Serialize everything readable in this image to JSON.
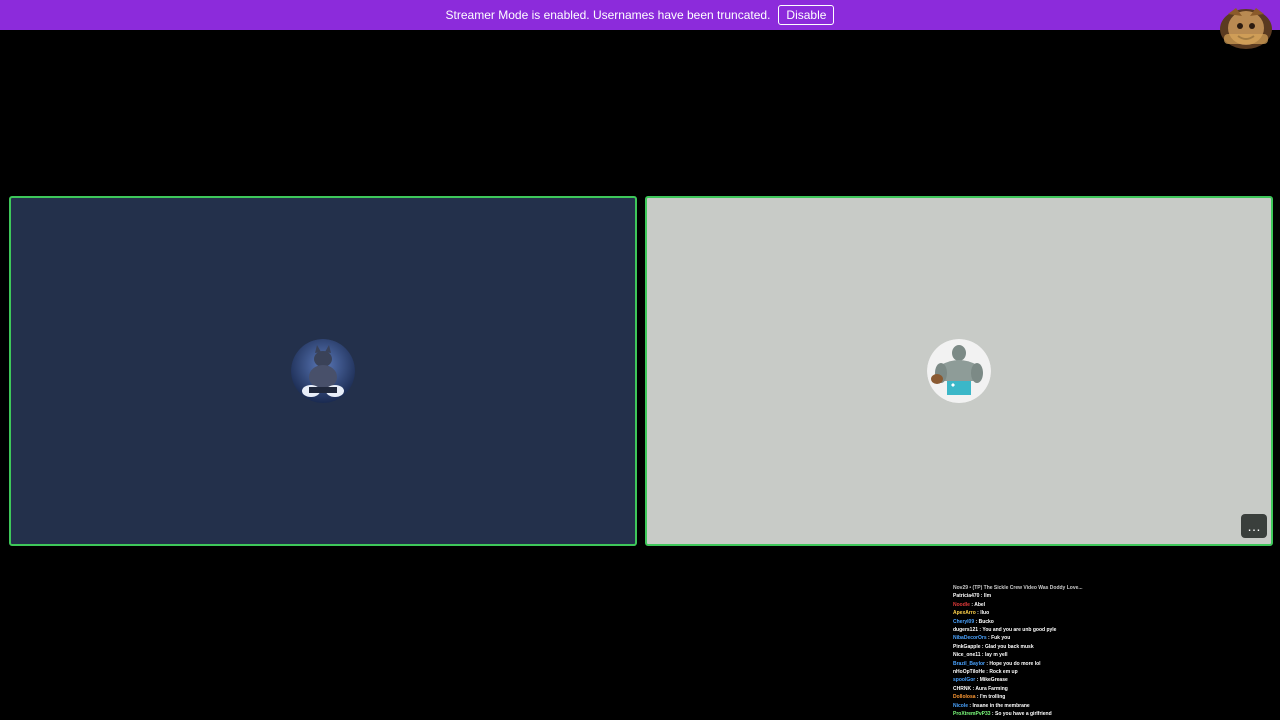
{
  "banner": {
    "text": "Streamer Mode is enabled. Usernames have been truncated.",
    "button_label": "Disable"
  },
  "tiles": [
    {
      "name": "tile-left",
      "avatar_icon": "cat-avatar-icon",
      "background": "#23304b"
    },
    {
      "name": "tile-right",
      "avatar_icon": "hulk-avatar-icon",
      "background": "#c8cbc7",
      "more_icon": "more-options-icon",
      "more_label": "…"
    }
  ],
  "colors": {
    "banner": "#8c2bdb",
    "speaking_border": "#3ec75a",
    "background": "#000000"
  },
  "chat": {
    "partial_top": "Nov29 • (TP) The Sickle Crew Video Was Doddy Love...",
    "messages": [
      {
        "user": "Patricia470",
        "sep": " : ",
        "text": "llm",
        "color": "#ffffff"
      },
      {
        "user": "Noodle",
        "sep": " : ",
        "text": "Abel",
        "color": "#e23a3a"
      },
      {
        "user": "ApexArro",
        "sep": " : ",
        "text": "lluo",
        "color": "#ffd24a"
      },
      {
        "user": "Cheryl09",
        "sep": " : ",
        "text": "Bucko",
        "color": "#4aa3ff"
      },
      {
        "user": "dugers121",
        "sep": " : ",
        "text": "You and you are unb good pyle",
        "color": "#ffffff"
      },
      {
        "user": "NibaDecorOrs",
        "sep": " : ",
        "text": "Fuk you",
        "color": "#4aa3ff"
      },
      {
        "user": "PinkGapple",
        "sep": " : ",
        "text": "Glad you back musk",
        "color": "#ffffff"
      },
      {
        "user": "Nice_one11",
        "sep": " : ",
        "text": "lay m yell",
        "color": "#ffffff"
      },
      {
        "user": "Brazil_Baylor",
        "sep": " : ",
        "text": "Hope you do more lol",
        "color": "#4aa3ff"
      },
      {
        "user": "nHoOpTiloHe",
        "sep": " : ",
        "text": "Rock em up",
        "color": "#ffffff"
      },
      {
        "user": "spoolGor",
        "sep": " : ",
        "text": "MikeGrease",
        "color": "#4aa3ff"
      },
      {
        "user": "CHRNK",
        "sep": " : ",
        "text": "Aura Farming",
        "color": "#ffffff"
      },
      {
        "user": "Dollolosa",
        "sep": " : ",
        "text": "I'm trolling",
        "color": "#ff9933"
      },
      {
        "user": "Nicole",
        "sep": " : ",
        "text": "Insane in the membrane",
        "color": "#4aa3ff"
      },
      {
        "user": "ProXtremPvP33",
        "sep": " : ",
        "text": "So you have a girlfriend",
        "color": "#7cff7c"
      }
    ]
  }
}
